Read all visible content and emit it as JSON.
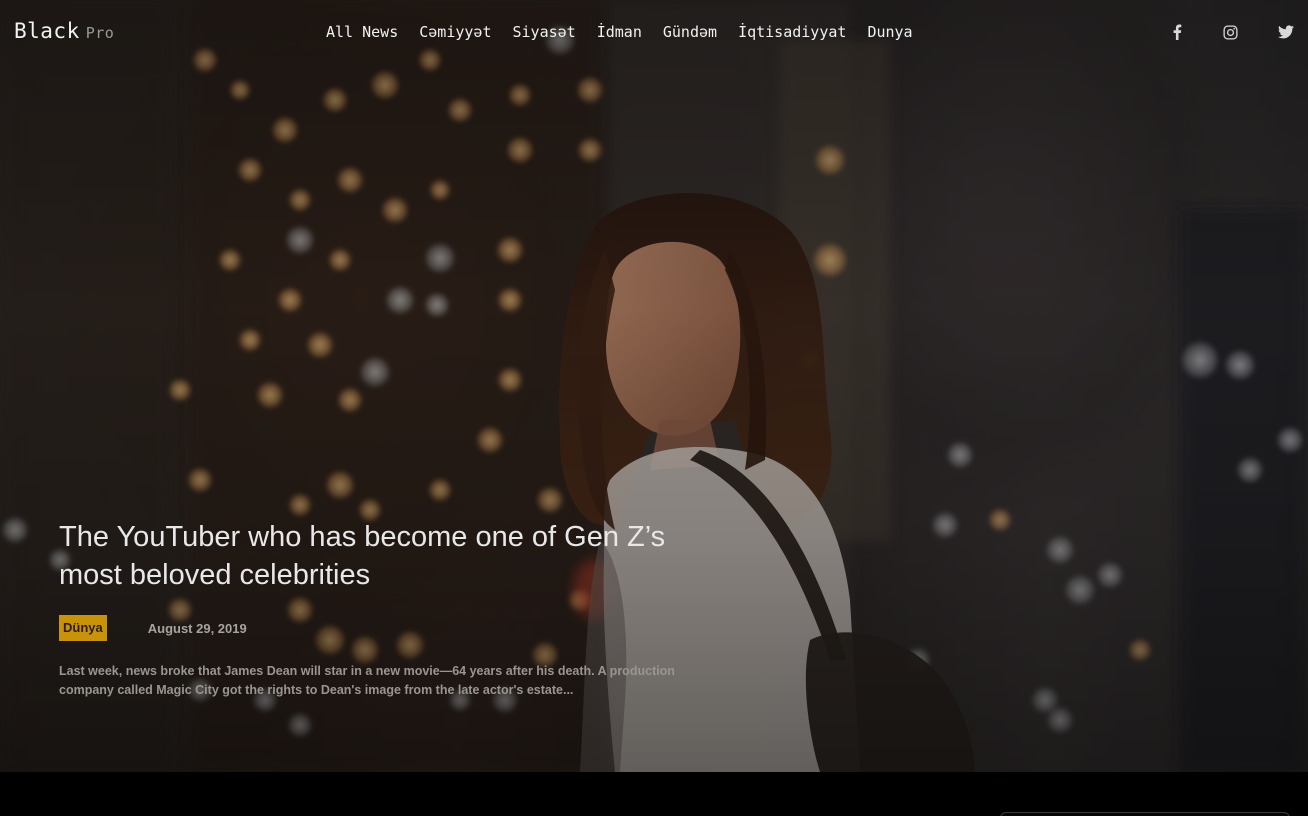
{
  "brand": {
    "name": "Black",
    "sub": "Pro"
  },
  "nav": {
    "items": [
      "All News",
      "Cəmiyyət",
      "Siyasət",
      "İdman",
      "Gündəm",
      "İqtisadiyyat",
      "Dunya"
    ]
  },
  "social": {
    "icons": [
      "facebook-icon",
      "instagram-icon",
      "twitter-icon"
    ]
  },
  "hero": {
    "title": "The YouTuber who has become one of Gen Z’s most beloved celebrities",
    "category": "Dünya",
    "date": "August 29, 2019",
    "excerpt": "Last week, news broke that James Dean will star in a new movie—64 years after his death. A production company called Magic City got the rights to Dean's image from the late actor's estate..."
  },
  "colors": {
    "badge": "#c8930a",
    "background": "#000000",
    "text": "#e8e8e8"
  }
}
